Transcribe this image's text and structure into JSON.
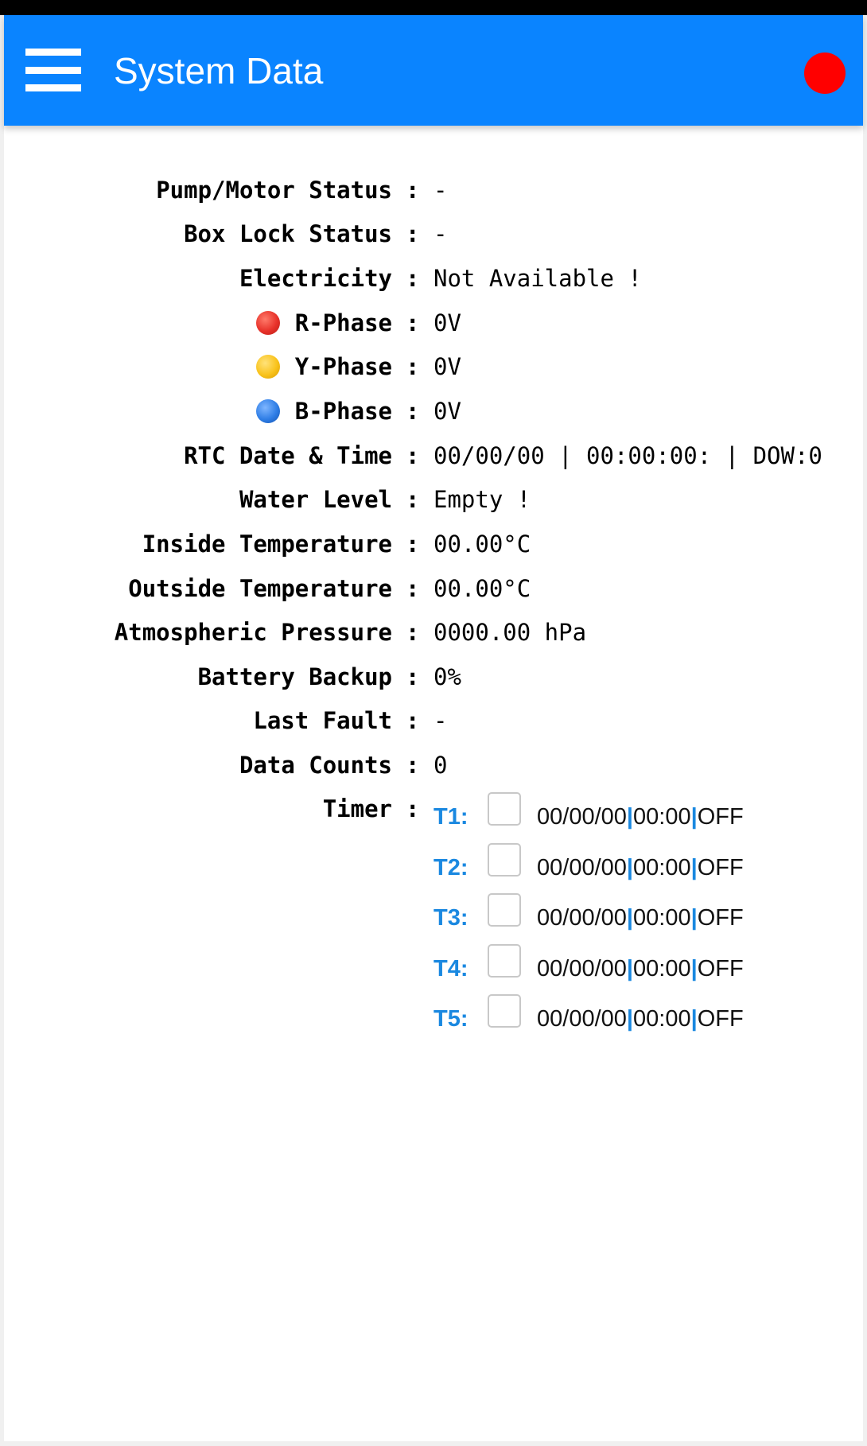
{
  "header": {
    "title": "System Data",
    "menu_icon": "hamburger-menu-icon",
    "status_indicator_color": "#ff0000"
  },
  "colors": {
    "header_bg": "#0a84ff",
    "timer_accent": "#1a88e0"
  },
  "rows": {
    "pump_motor": {
      "label": "Pump/Motor Status",
      "colon": ":",
      "value": "-"
    },
    "box_lock": {
      "label": "Box Lock Status",
      "colon": ":",
      "value": "-"
    },
    "electricity": {
      "label": "Electricity",
      "colon": ":",
      "value": "Not Available !"
    },
    "r_phase": {
      "label": "R-Phase",
      "colon": ":",
      "value": "0V",
      "icon": "red-circle-icon"
    },
    "y_phase": {
      "label": "Y-Phase",
      "colon": ":",
      "value": "0V",
      "icon": "yellow-circle-icon"
    },
    "b_phase": {
      "label": "B-Phase",
      "colon": ":",
      "value": "0V",
      "icon": "blue-circle-icon"
    },
    "rtc": {
      "label": "RTC Date & Time",
      "colon": ":",
      "value": "00/00/00 | 00:00:00: | DOW:0"
    },
    "water_level": {
      "label": "Water Level",
      "colon": ":",
      "value": "Empty !"
    },
    "inside_temp": {
      "label": "Inside Temperature",
      "colon": ":",
      "value": "00.00°C"
    },
    "outside_temp": {
      "label": "Outside Temperature",
      "colon": ":",
      "value": "00.00°C"
    },
    "pressure": {
      "label": "Atmospheric Pressure",
      "colon": ":",
      "value": "0000.00 hPa"
    },
    "battery": {
      "label": "Battery Backup",
      "colon": ":",
      "value": "0%"
    },
    "last_fault": {
      "label": "Last Fault",
      "colon": ":",
      "value": "-"
    },
    "data_counts": {
      "label": "Data Counts",
      "colon": ":",
      "value": "0"
    },
    "timer": {
      "label": "Timer",
      "colon": ":"
    }
  },
  "timers": [
    {
      "name": "T1:",
      "checked": false,
      "date": "00/00/00",
      "sep1": "|",
      "time": "00:00",
      "sep2": "|",
      "state": "OFF"
    },
    {
      "name": "T2:",
      "checked": false,
      "date": "00/00/00",
      "sep1": "|",
      "time": "00:00",
      "sep2": "|",
      "state": "OFF"
    },
    {
      "name": "T3:",
      "checked": false,
      "date": "00/00/00",
      "sep1": "|",
      "time": "00:00",
      "sep2": "|",
      "state": "OFF"
    },
    {
      "name": "T4:",
      "checked": false,
      "date": "00/00/00",
      "sep1": "|",
      "time": "00:00",
      "sep2": "|",
      "state": "OFF"
    },
    {
      "name": "T5:",
      "checked": false,
      "date": "00/00/00",
      "sep1": "|",
      "time": "00:00",
      "sep2": "|",
      "state": "OFF"
    }
  ]
}
